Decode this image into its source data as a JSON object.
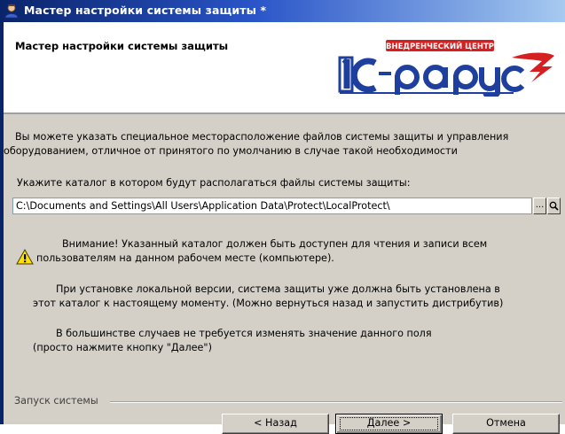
{
  "window": {
    "title": "Мастер настройки системы защиты *"
  },
  "header": {
    "title": "Мастер настройки системы защиты",
    "logo": {
      "banner_text": "ВНЕДРЕНЧЕСКИЙ ЦЕНТР",
      "brand_text": "1С-Рарус",
      "colors": {
        "blue": "#1e3f9e",
        "red": "#d42020"
      }
    }
  },
  "body": {
    "intro_line1": "Вы можете указать специальное месторасположение файлов системы защиты и управления",
    "intro_line2": "оборудованием, отличное от принятого по умолчанию в случае такой необходимости",
    "path_label": "Укажите каталог в котором будут располагаться файлы системы защиты:",
    "path_value": "C:\\Documents and Settings\\All Users\\Application Data\\Protect\\LocalProtect\\",
    "browse_label": "...",
    "search_icon": "magnifier-icon",
    "warning_icon": "warning-icon",
    "warning_line1": "Внимание! Указанный каталог должен быть доступен для чтения и записи всем",
    "warning_line2": "пользователям на данном рабочем месте (компьютере).",
    "local_line1": "При установке локальной версии, система защиты уже должна быть установлена в",
    "local_line2": "этот каталог к настоящему моменту. (Можно вернуться назад и запустить дистрибутив)",
    "default_line1": "В большинстве случаев не требуется изменять значение данного поля",
    "default_line2": "(просто нажмите кнопку \"Далее\")"
  },
  "footer": {
    "group_label": "Запуск системы",
    "back_label": "< Назад",
    "next_label": "Далее >",
    "cancel_label": "Отмена"
  }
}
